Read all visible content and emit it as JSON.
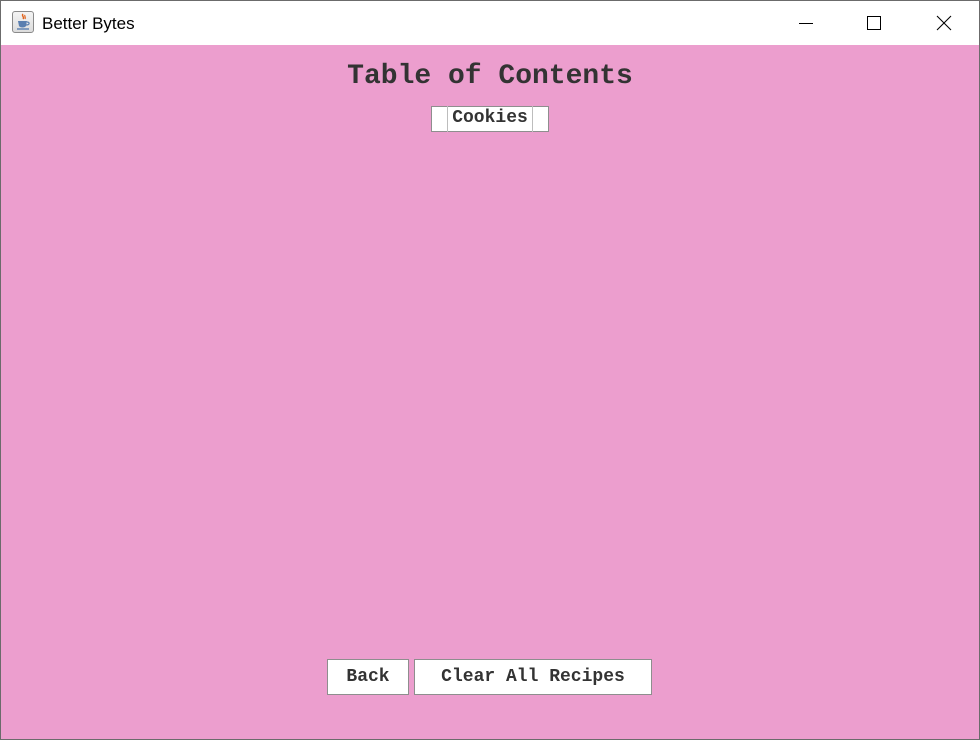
{
  "window": {
    "title": "Better Bytes",
    "icon": "java-cup-icon",
    "controls": [
      "minimize-icon",
      "maximize-icon",
      "close-icon"
    ]
  },
  "content": {
    "heading": "Table of Contents",
    "recipes": [
      "Cookies"
    ],
    "back_label": "Back",
    "clear_label": "Clear All Recipes",
    "background_color": "#ec9ece"
  }
}
